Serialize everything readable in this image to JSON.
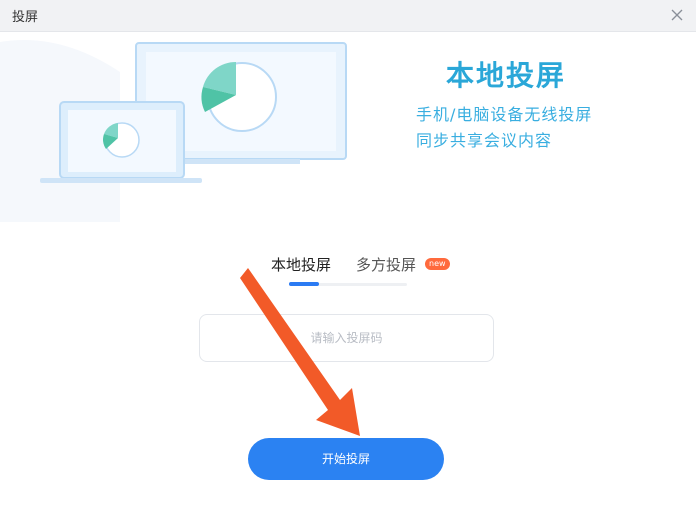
{
  "window": {
    "title": "投屏",
    "close_icon": "close-icon"
  },
  "hero": {
    "title": "本地投屏",
    "subtitle_line1": "手机/电脑设备无线投屏",
    "subtitle_line2": "同步共享会议内容",
    "illustration": "screen-cast-illustration",
    "accent_color": "#2aa7d8"
  },
  "tabs": {
    "local": "本地投屏",
    "multi": "多方投屏",
    "new_badge": "new",
    "active": "本地投屏"
  },
  "input": {
    "placeholder": "请输入投屏码",
    "value": ""
  },
  "button": {
    "start_label": "开始投屏",
    "color": "#2b82f2"
  },
  "annotation": {
    "arrow_color": "#f25a28"
  }
}
